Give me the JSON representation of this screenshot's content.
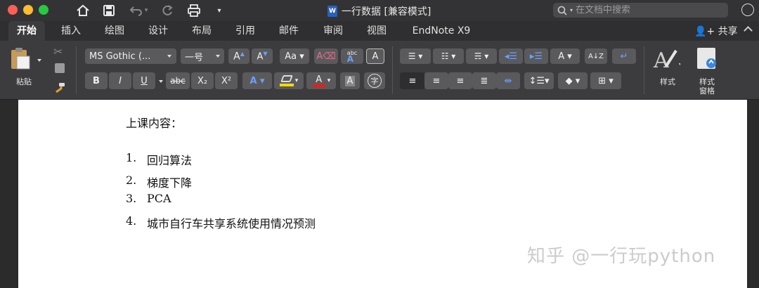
{
  "window": {
    "title": "一行数据 [兼容模式]",
    "file_badge": "W"
  },
  "search": {
    "placeholder": "在文档中搜索"
  },
  "tabs": [
    {
      "label": "开始",
      "active": true
    },
    {
      "label": "插入"
    },
    {
      "label": "绘图"
    },
    {
      "label": "设计"
    },
    {
      "label": "布局"
    },
    {
      "label": "引用"
    },
    {
      "label": "邮件"
    },
    {
      "label": "审阅"
    },
    {
      "label": "视图"
    },
    {
      "label": "EndNote X9"
    }
  ],
  "share_label": "共享",
  "ribbon": {
    "paste_label": "粘贴",
    "font_name": "MS Gothic (...",
    "font_size": "一号",
    "bold": "B",
    "italic": "I",
    "underline": "U",
    "strikethrough": "abc",
    "subscript": "X₂",
    "superscript": "X²",
    "styles_label": "样式",
    "styles_pane_label_1": "样式",
    "styles_pane_label_2": "窗格"
  },
  "document": {
    "heading": "上课内容：",
    "items": [
      {
        "num": "1.",
        "text": "回归算法"
      },
      {
        "num": "2.",
        "text": "梯度下降"
      },
      {
        "num": "3.",
        "text": "PCA"
      },
      {
        "num": "4.",
        "text": "城市自行车共享系统使用情况预测"
      }
    ]
  },
  "watermark": "知乎 @一行玩python",
  "colors": {
    "titlebar": "#333335",
    "ribbon": "#3c3c3e",
    "page": "#ffffff",
    "highlight_yellow": "#f5d800",
    "font_color_red": "#e02020",
    "word_blue": "#2b5fb8"
  }
}
